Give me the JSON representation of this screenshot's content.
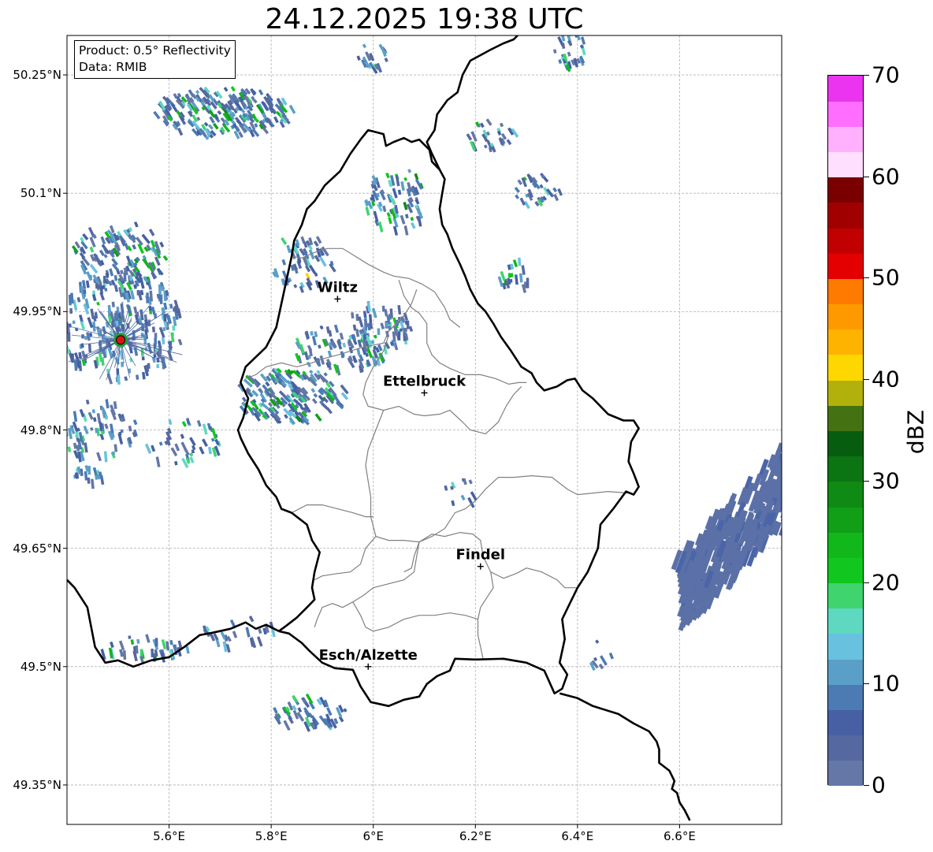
{
  "title": "24.12.2025 19:38 UTC",
  "info": {
    "product_line": "Product: 0.5° Reflectivity",
    "data_line": "Data: RMIB"
  },
  "map": {
    "lon_range": [
      5.4,
      6.8
    ],
    "lat_range": [
      49.3,
      50.3
    ],
    "lat_ticks": [
      {
        "value": 50.25,
        "label": "50.25°N"
      },
      {
        "value": 50.1,
        "label": "50.1°N"
      },
      {
        "value": 49.95,
        "label": "49.95°N"
      },
      {
        "value": 49.8,
        "label": "49.8°N"
      },
      {
        "value": 49.65,
        "label": "49.65°N"
      },
      {
        "value": 49.5,
        "label": "49.5°N"
      },
      {
        "value": 49.35,
        "label": "49.35°N"
      }
    ],
    "lon_ticks": [
      {
        "value": 5.6,
        "label": "5.6°E"
      },
      {
        "value": 5.8,
        "label": "5.8°E"
      },
      {
        "value": 6.0,
        "label": "6°E"
      },
      {
        "value": 6.2,
        "label": "6.2°E"
      },
      {
        "value": 6.4,
        "label": "6.4°E"
      },
      {
        "value": 6.6,
        "label": "6.6°E"
      }
    ],
    "grid": true,
    "cities": [
      {
        "name": "Wiltz",
        "lon": 5.93,
        "lat": 49.966
      },
      {
        "name": "Ettelbruck",
        "lon": 6.1,
        "lat": 49.847
      },
      {
        "name": "Findel",
        "lon": 6.21,
        "lat": 49.627
      },
      {
        "name": "Esch/Alzette",
        "lon": 5.99,
        "lat": 49.5
      }
    ],
    "radar_site": {
      "lon": 5.505,
      "lat": 49.914,
      "color": "#dd1111"
    },
    "country_border": [
      [
        5.815,
        49.545
      ],
      [
        5.79,
        49.553
      ],
      [
        5.77,
        49.548
      ],
      [
        5.75,
        49.556
      ],
      [
        5.72,
        49.548
      ],
      [
        5.685,
        49.543
      ],
      [
        5.66,
        49.54
      ],
      [
        5.63,
        49.525
      ],
      [
        5.6,
        49.512
      ],
      [
        5.565,
        49.508
      ],
      [
        5.53,
        49.5
      ],
      [
        5.5,
        49.508
      ],
      [
        5.475,
        49.505
      ],
      [
        5.455,
        49.525
      ],
      [
        5.44,
        49.575
      ],
      [
        5.415,
        49.6
      ],
      [
        5.4,
        49.61
      ]
    ],
    "lux_border": [
      [
        5.815,
        49.545
      ],
      [
        5.835,
        49.542
      ],
      [
        5.86,
        49.53
      ],
      [
        5.875,
        49.52
      ],
      [
        5.9,
        49.505
      ],
      [
        5.925,
        49.498
      ],
      [
        5.96,
        49.496
      ],
      [
        5.975,
        49.475
      ],
      [
        5.995,
        49.455
      ],
      [
        6.03,
        49.45
      ],
      [
        6.06,
        49.458
      ],
      [
        6.09,
        49.462
      ],
      [
        6.105,
        49.478
      ],
      [
        6.125,
        49.488
      ],
      [
        6.15,
        49.495
      ],
      [
        6.16,
        49.51
      ],
      [
        6.2,
        49.509
      ],
      [
        6.255,
        49.51
      ],
      [
        6.3,
        49.505
      ],
      [
        6.335,
        49.495
      ],
      [
        6.355,
        49.466
      ],
      [
        6.37,
        49.472
      ],
      [
        6.38,
        49.49
      ],
      [
        6.365,
        49.505
      ],
      [
        6.375,
        49.535
      ],
      [
        6.37,
        49.56
      ],
      [
        6.385,
        49.58
      ],
      [
        6.4,
        49.6
      ],
      [
        6.42,
        49.62
      ],
      [
        6.44,
        49.65
      ],
      [
        6.445,
        49.68
      ],
      [
        6.47,
        49.7
      ],
      [
        6.495,
        49.722
      ],
      [
        6.51,
        49.718
      ],
      [
        6.52,
        49.728
      ],
      [
        6.51,
        49.745
      ],
      [
        6.5,
        49.76
      ],
      [
        6.505,
        49.785
      ],
      [
        6.52,
        49.802
      ],
      [
        6.51,
        49.812
      ],
      [
        6.49,
        49.812
      ],
      [
        6.46,
        49.82
      ],
      [
        6.43,
        49.84
      ],
      [
        6.41,
        49.85
      ],
      [
        6.395,
        49.865
      ],
      [
        6.38,
        49.863
      ],
      [
        6.36,
        49.855
      ],
      [
        6.335,
        49.85
      ],
      [
        6.32,
        49.86
      ],
      [
        6.31,
        49.872
      ],
      [
        6.29,
        49.88
      ],
      [
        6.27,
        49.9
      ],
      [
        6.25,
        49.918
      ],
      [
        6.235,
        49.935
      ],
      [
        6.22,
        49.95
      ],
      [
        6.205,
        49.96
      ],
      [
        6.19,
        49.978
      ],
      [
        6.18,
        49.995
      ],
      [
        6.17,
        50.01
      ],
      [
        6.155,
        50.03
      ],
      [
        6.145,
        50.048
      ],
      [
        6.135,
        50.06
      ],
      [
        6.13,
        50.08
      ],
      [
        6.135,
        50.1
      ],
      [
        6.14,
        50.118
      ],
      [
        6.13,
        50.13
      ],
      [
        6.115,
        50.14
      ],
      [
        6.11,
        50.155
      ],
      [
        6.09,
        50.168
      ],
      [
        6.075,
        50.165
      ],
      [
        6.06,
        50.17
      ],
      [
        6.04,
        50.165
      ],
      [
        6.025,
        50.16
      ],
      [
        6.02,
        50.175
      ],
      [
        5.99,
        50.18
      ],
      [
        5.975,
        50.168
      ],
      [
        5.955,
        50.15
      ],
      [
        5.935,
        50.128
      ],
      [
        5.905,
        50.11
      ],
      [
        5.885,
        50.09
      ],
      [
        5.87,
        50.08
      ],
      [
        5.86,
        50.06
      ],
      [
        5.845,
        50.04
      ],
      [
        5.84,
        50.02
      ],
      [
        5.83,
        49.99
      ],
      [
        5.82,
        49.96
      ],
      [
        5.81,
        49.93
      ],
      [
        5.79,
        49.905
      ],
      [
        5.75,
        49.88
      ],
      [
        5.74,
        49.86
      ],
      [
        5.755,
        49.84
      ],
      [
        5.745,
        49.815
      ],
      [
        5.735,
        49.8
      ],
      [
        5.74,
        49.79
      ],
      [
        5.755,
        49.77
      ],
      [
        5.775,
        49.75
      ],
      [
        5.79,
        49.73
      ],
      [
        5.81,
        49.715
      ],
      [
        5.82,
        49.7
      ],
      [
        5.84,
        49.695
      ],
      [
        5.87,
        49.68
      ],
      [
        5.88,
        49.66
      ],
      [
        5.895,
        49.645
      ],
      [
        5.885,
        49.62
      ],
      [
        5.88,
        49.6
      ],
      [
        5.885,
        49.585
      ],
      [
        5.87,
        49.575
      ],
      [
        5.85,
        49.562
      ],
      [
        5.83,
        49.552
      ],
      [
        5.815,
        49.545
      ]
    ],
    "de_be_border": [
      [
        6.13,
        50.13
      ],
      [
        6.115,
        50.15
      ],
      [
        6.105,
        50.165
      ],
      [
        6.12,
        50.18
      ],
      [
        6.125,
        50.2
      ],
      [
        6.145,
        50.218
      ],
      [
        6.165,
        50.228
      ],
      [
        6.175,
        50.25
      ],
      [
        6.19,
        50.268
      ],
      [
        6.21,
        50.275
      ],
      [
        6.23,
        50.282
      ],
      [
        6.255,
        50.29
      ],
      [
        6.275,
        50.295
      ],
      [
        6.29,
        50.305
      ]
    ],
    "de_fr_border": [
      [
        6.365,
        49.466
      ],
      [
        6.4,
        49.46
      ],
      [
        6.43,
        49.45
      ],
      [
        6.48,
        49.44
      ],
      [
        6.51,
        49.428
      ],
      [
        6.54,
        49.418
      ],
      [
        6.555,
        49.405
      ],
      [
        6.56,
        49.395
      ],
      [
        6.56,
        49.378
      ],
      [
        6.58,
        49.368
      ],
      [
        6.59,
        49.355
      ],
      [
        6.585,
        49.345
      ],
      [
        6.595,
        49.34
      ],
      [
        6.6,
        49.328
      ],
      [
        6.61,
        49.318
      ],
      [
        6.62,
        49.305
      ]
    ],
    "cantons": [
      [
        [
          5.84,
          50.02
        ],
        [
          5.86,
          50.018
        ],
        [
          5.885,
          50.025
        ],
        [
          5.91,
          50.03
        ],
        [
          5.94,
          50.03
        ],
        [
          5.96,
          50.022
        ],
        [
          5.99,
          50.01
        ],
        [
          6.02,
          50.0
        ],
        [
          6.04,
          49.995
        ],
        [
          6.07,
          49.992
        ],
        [
          6.095,
          49.985
        ],
        [
          6.12,
          49.975
        ],
        [
          6.14,
          49.955
        ],
        [
          6.15,
          49.94
        ],
        [
          6.17,
          49.93
        ]
      ],
      [
        [
          6.05,
          49.99
        ],
        [
          6.06,
          49.97
        ],
        [
          6.075,
          49.955
        ],
        [
          6.09,
          49.948
        ],
        [
          6.105,
          49.935
        ],
        [
          6.105,
          49.91
        ],
        [
          6.115,
          49.895
        ],
        [
          6.13,
          49.885
        ],
        [
          6.15,
          49.878
        ],
        [
          6.18,
          49.87
        ],
        [
          6.21,
          49.87
        ],
        [
          6.24,
          49.865
        ],
        [
          6.265,
          49.858
        ],
        [
          6.285,
          49.86
        ],
        [
          6.3,
          49.86
        ]
      ],
      [
        [
          6.085,
          49.978
        ],
        [
          6.075,
          49.96
        ],
        [
          6.06,
          49.945
        ],
        [
          6.045,
          49.935
        ],
        [
          6.03,
          49.925
        ],
        [
          6.02,
          49.91
        ],
        [
          5.98,
          49.905
        ],
        [
          5.955,
          49.9
        ],
        [
          5.93,
          49.895
        ],
        [
          5.9,
          49.89
        ],
        [
          5.88,
          49.885
        ],
        [
          5.85,
          49.88
        ],
        [
          5.82,
          49.885
        ],
        [
          5.79,
          49.88
        ],
        [
          5.77,
          49.87
        ],
        [
          5.75,
          49.865
        ]
      ],
      [
        [
          6.03,
          49.92
        ],
        [
          6.02,
          49.9
        ],
        [
          6.0,
          49.88
        ],
        [
          5.985,
          49.86
        ],
        [
          5.98,
          49.845
        ],
        [
          5.99,
          49.83
        ],
        [
          6.02,
          49.825
        ],
        [
          6.05,
          49.83
        ],
        [
          6.08,
          49.82
        ],
        [
          6.1,
          49.818
        ],
        [
          6.13,
          49.82
        ],
        [
          6.15,
          49.825
        ],
        [
          6.175,
          49.81
        ],
        [
          6.19,
          49.8
        ],
        [
          6.22,
          49.795
        ],
        [
          6.245,
          49.81
        ],
        [
          6.26,
          49.83
        ],
        [
          6.275,
          49.845
        ],
        [
          6.29,
          49.855
        ]
      ],
      [
        [
          6.02,
          49.825
        ],
        [
          6.005,
          49.8
        ],
        [
          5.99,
          49.775
        ],
        [
          5.985,
          49.755
        ],
        [
          5.99,
          49.735
        ],
        [
          5.995,
          49.715
        ],
        [
          5.995,
          49.69
        ],
        [
          6.005,
          49.665
        ],
        [
          6.03,
          49.66
        ],
        [
          6.06,
          49.66
        ],
        [
          6.09,
          49.658
        ],
        [
          6.115,
          49.665
        ],
        [
          6.14,
          49.675
        ],
        [
          6.16,
          49.695
        ],
        [
          6.18,
          49.7
        ],
        [
          6.2,
          49.71
        ],
        [
          6.22,
          49.725
        ],
        [
          6.245,
          49.74
        ],
        [
          6.275,
          49.74
        ],
        [
          6.31,
          49.742
        ],
        [
          6.35,
          49.74
        ],
        [
          6.38,
          49.725
        ],
        [
          6.4,
          49.718
        ],
        [
          6.43,
          49.72
        ],
        [
          6.46,
          49.722
        ],
        [
          6.5,
          49.72
        ]
      ],
      [
        [
          5.84,
          49.695
        ],
        [
          5.87,
          49.705
        ],
        [
          5.9,
          49.705
        ],
        [
          5.93,
          49.7
        ],
        [
          5.96,
          49.695
        ],
        [
          5.985,
          49.69
        ],
        [
          6.0,
          49.69
        ]
      ],
      [
        [
          6.005,
          49.665
        ],
        [
          5.985,
          49.65
        ],
        [
          5.975,
          49.63
        ],
        [
          5.955,
          49.62
        ],
        [
          5.93,
          49.618
        ],
        [
          5.9,
          49.615
        ],
        [
          5.885,
          49.61
        ]
      ],
      [
        [
          6.09,
          49.658
        ],
        [
          6.085,
          49.64
        ],
        [
          6.08,
          49.62
        ],
        [
          6.06,
          49.61
        ],
        [
          6.03,
          49.605
        ],
        [
          6.0,
          49.6
        ],
        [
          5.98,
          49.59
        ],
        [
          5.96,
          49.582
        ],
        [
          5.94,
          49.575
        ],
        [
          5.92,
          49.58
        ],
        [
          5.9,
          49.575
        ],
        [
          5.89,
          49.56
        ],
        [
          5.885,
          49.55
        ]
      ],
      [
        [
          6.09,
          49.658
        ],
        [
          6.115,
          49.668
        ],
        [
          6.14,
          49.665
        ],
        [
          6.17,
          49.67
        ],
        [
          6.195,
          49.668
        ],
        [
          6.21,
          49.66
        ],
        [
          6.215,
          49.64
        ],
        [
          6.23,
          49.62
        ],
        [
          6.255,
          49.612
        ],
        [
          6.28,
          49.618
        ],
        [
          6.3,
          49.625
        ],
        [
          6.33,
          49.62
        ],
        [
          6.36,
          49.61
        ],
        [
          6.375,
          49.6
        ],
        [
          6.4,
          49.6
        ]
      ],
      [
        [
          6.23,
          49.62
        ],
        [
          6.235,
          49.6
        ],
        [
          6.22,
          49.585
        ],
        [
          6.21,
          49.575
        ],
        [
          6.205,
          49.56
        ],
        [
          6.205,
          49.54
        ],
        [
          6.21,
          49.525
        ],
        [
          6.215,
          49.51
        ]
      ],
      [
        [
          5.96,
          49.582
        ],
        [
          5.975,
          49.565
        ],
        [
          5.985,
          49.55
        ],
        [
          6.0,
          49.545
        ],
        [
          6.03,
          49.55
        ],
        [
          6.06,
          49.56
        ],
        [
          6.09,
          49.565
        ],
        [
          6.12,
          49.565
        ],
        [
          6.15,
          49.568
        ],
        [
          6.18,
          49.565
        ],
        [
          6.205,
          49.56
        ]
      ],
      [
        [
          6.06,
          49.62
        ],
        [
          6.075,
          49.625
        ],
        [
          6.08,
          49.64
        ],
        [
          6.09,
          49.658
        ]
      ]
    ]
  },
  "colorbar": {
    "label": "dBZ",
    "min": 0,
    "max": 70,
    "ticks": [
      0,
      10,
      20,
      30,
      40,
      50,
      60,
      70
    ],
    "colors": [
      "#6477a6",
      "#5568a0",
      "#4660a3",
      "#4c7ab3",
      "#5a9fc8",
      "#68c2df",
      "#5fd8c2",
      "#3fd46e",
      "#11c71f",
      "#11b71b",
      "#119f17",
      "#0f8a14",
      "#0b7413",
      "#075d0f",
      "#447212",
      "#b2b10b",
      "#fed600",
      "#fdb300",
      "#fe9a00",
      "#fe7a00",
      "#e40001",
      "#c10002",
      "#a10001",
      "#7a0000",
      "#ffdefe",
      "#ffb1fe",
      "#ff6efe",
      "#ea34ef"
    ]
  }
}
